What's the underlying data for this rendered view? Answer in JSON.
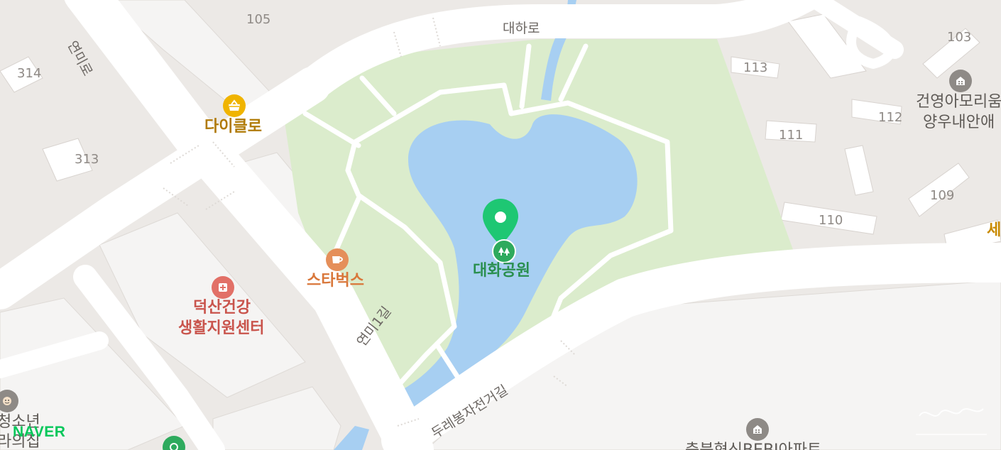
{
  "colors": {
    "land": "#ece9e6",
    "block": "#f5f4f3",
    "block_outline": "#dedad6",
    "road": "#ffffff",
    "park": "#dbeccc",
    "park_dark": "#cfe5bd",
    "water": "#a7cff2",
    "marker": "#1ec773",
    "poi_green": "#2eaa5d",
    "poi_orange": "#e58f5a",
    "poi_red": "#d9534f",
    "poi_gold": "#f0b400",
    "poi_gray": "#8e8a86"
  },
  "map": {
    "roads": {
      "daharo": "대하로",
      "yeonmiro": "연미로",
      "yeonmi1gil": "연미1길",
      "bike_path": "두레봉자전거길"
    },
    "building_numbers": [
      "105",
      "314",
      "313",
      "103",
      "113",
      "112",
      "111",
      "109",
      "110"
    ],
    "pois": {
      "park": {
        "name": "대화공원",
        "icon": "tree-icon"
      },
      "starbucks": {
        "name": "스타벅스",
        "icon": "cafe-icon"
      },
      "daiclo": {
        "name": "다이클로",
        "icon": "shopping-basket-icon"
      },
      "health_center": {
        "line1": "덕산건강",
        "line2": "생활지원센터",
        "icon": "medical-cross-icon"
      },
      "apartment_right": {
        "line1": "건영아모리움",
        "line2": "양우내안애",
        "icon": "apartment-icon"
      },
      "apartment_bottom": {
        "name": "충북혁신BEBI아파트",
        "icon": "apartment-icon"
      },
      "youth": {
        "line1": "청소년",
        "line2": "라의집",
        "icon": "face-icon"
      },
      "right_edge_text": "세"
    },
    "brand": "NAVER"
  }
}
